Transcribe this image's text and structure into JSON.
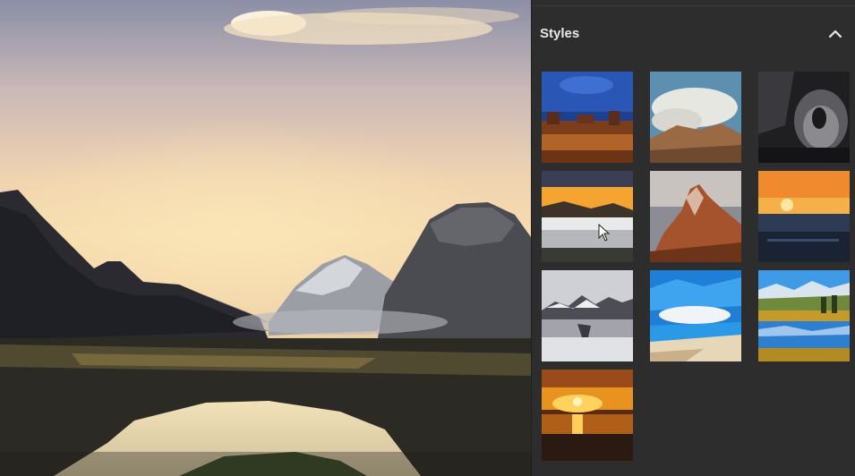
{
  "panel": {
    "section_title": "Styles",
    "collapse_icon": "chevron-up-icon"
  },
  "canvas": {
    "image": "mountain-lake-sunset-photo"
  },
  "styles": [
    {
      "name": "style-1",
      "icon": "desert-mesa-style"
    },
    {
      "name": "style-2",
      "icon": "cloudy-mountain-style"
    },
    {
      "name": "style-3",
      "icon": "dark-rock-style"
    },
    {
      "name": "style-4",
      "icon": "sunset-lake-style"
    },
    {
      "name": "style-5",
      "icon": "red-peak-style"
    },
    {
      "name": "style-6",
      "icon": "orange-sunset-sea-style"
    },
    {
      "name": "style-7",
      "icon": "misty-peaks-style"
    },
    {
      "name": "style-8",
      "icon": "blue-sky-beach-style"
    },
    {
      "name": "style-9",
      "icon": "alpine-reflection-style"
    },
    {
      "name": "style-10",
      "icon": "golden-sun-sea-style"
    }
  ],
  "colors": {
    "panel_bg": "#2d2d2e",
    "title_text": "#e8e8e8"
  }
}
